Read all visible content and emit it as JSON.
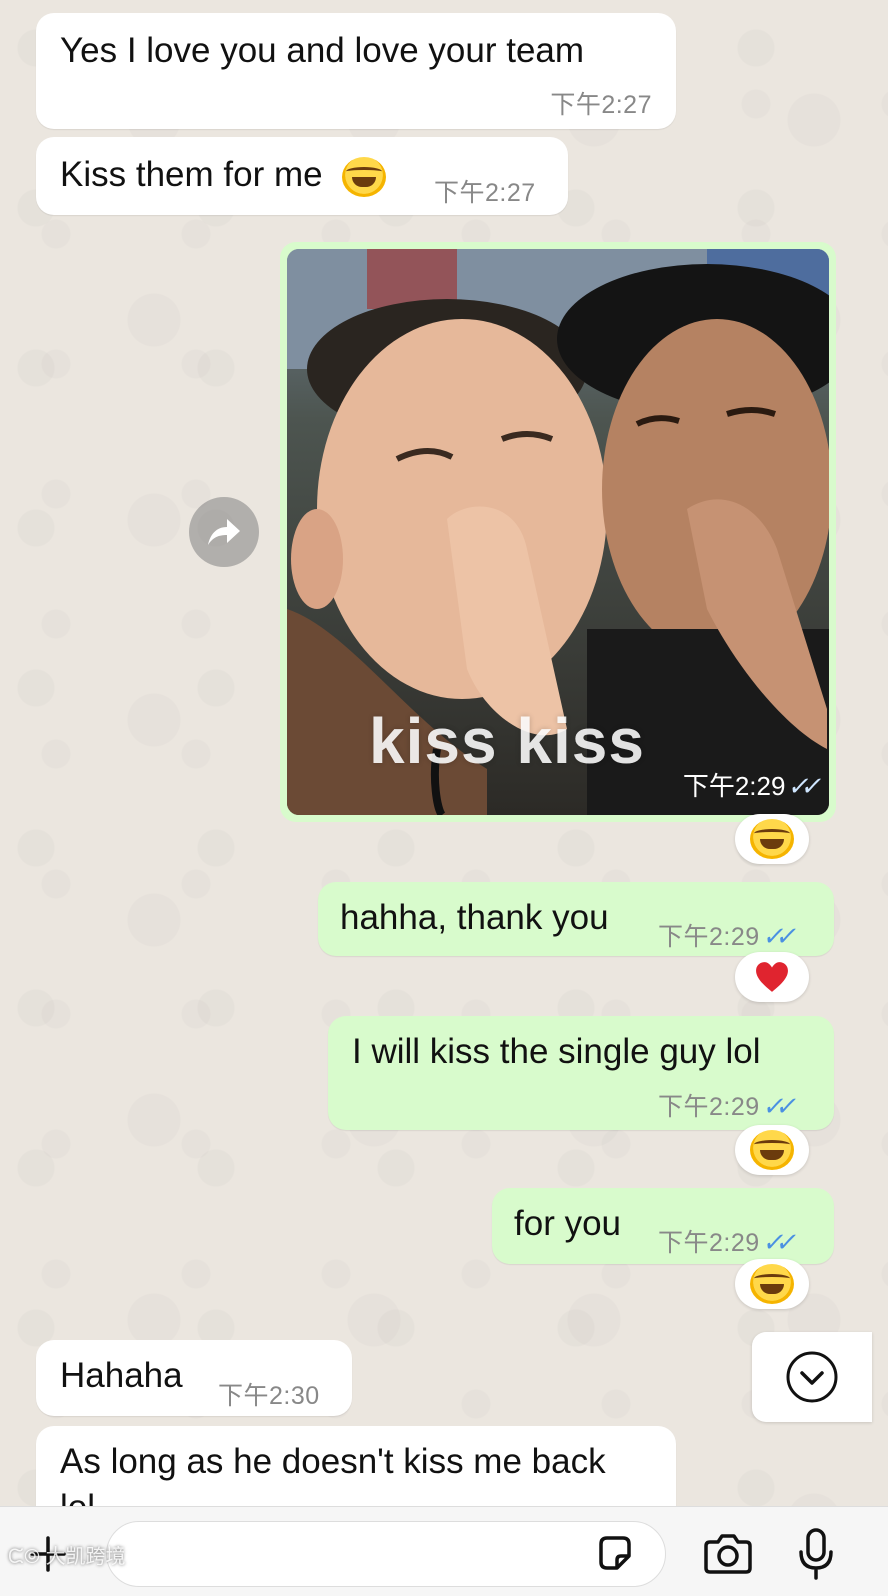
{
  "chat": {
    "messages": [
      {
        "text": "Yes I love you and love your team",
        "time": "下午2:27"
      },
      {
        "text": "Kiss them for me",
        "emoji": "face-with-tears-of-joy",
        "time": "下午2:27"
      },
      {
        "image_caption": "kiss kiss",
        "time": "下午2:29",
        "reaction": "face-with-tears-of-joy"
      },
      {
        "text": "hahha, thank you",
        "time": "下午2:29",
        "reaction": "red-heart"
      },
      {
        "text": "I will kiss the single guy lol",
        "time": "下午2:29",
        "reaction": "face-with-tears-of-joy"
      },
      {
        "text": "for you",
        "time": "下午2:29",
        "reaction": "face-with-tears-of-joy"
      },
      {
        "text": "Hahaha",
        "time": "下午2:30"
      },
      {
        "text": "As long as he doesn't kiss me back",
        "overflow_text": "lol"
      }
    ],
    "read_ticks": "✓✓"
  },
  "watermark": "大凯跨境",
  "colors": {
    "incoming_bubble": "#ffffff",
    "outgoing_bubble": "#d8fbcc",
    "read_tick": "#4a90e2",
    "wallpaper": "#ebe6df"
  },
  "icons": {
    "forward": "forward-arrow-icon",
    "scroll": "chevron-down-circle-icon",
    "attach": "plus-icon",
    "sticker": "sticker-icon",
    "camera": "camera-icon",
    "mic": "microphone-icon"
  }
}
